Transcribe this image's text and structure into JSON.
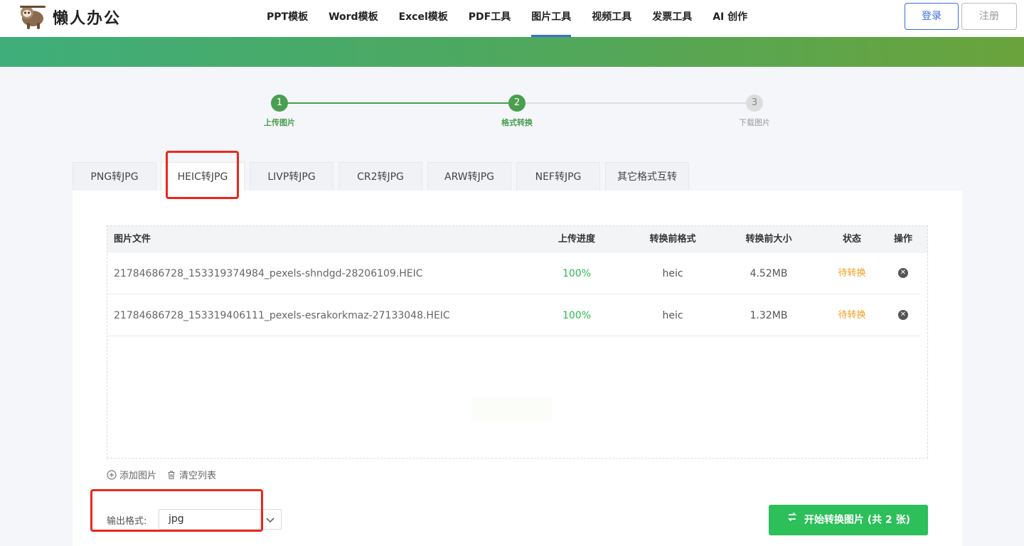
{
  "header": {
    "logo_text": "懒人办公",
    "nav": [
      "PPT模板",
      "Word模板",
      "Excel模板",
      "PDF工具",
      "图片工具",
      "视频工具",
      "发票工具",
      "AI 创作"
    ],
    "active_nav": "图片工具",
    "login_label": "登录",
    "register_label": "注册"
  },
  "steps": [
    {
      "num": "1",
      "label": "上传图片",
      "state": "done"
    },
    {
      "num": "2",
      "label": "格式转换",
      "state": "active"
    },
    {
      "num": "3",
      "label": "下载图片",
      "state": "pending"
    }
  ],
  "tabs": [
    "PNG转JPG",
    "HEIC转JPG",
    "LIVP转JPG",
    "CR2转JPG",
    "ARW转JPG",
    "NEF转JPG",
    "其它格式互转"
  ],
  "active_tab": "HEIC转JPG",
  "table": {
    "headers": {
      "file": "图片文件",
      "progress": "上传进度",
      "format": "转换前格式",
      "size": "转换前大小",
      "status": "状态",
      "action": "操作"
    },
    "rows": [
      {
        "file": "21784686728_153319374984_pexels-shndgd-28206109.HEIC",
        "progress": "100%",
        "format": "heic",
        "size": "4.52MB",
        "status": "待转换"
      },
      {
        "file": "21784686728_153319406111_pexels-esrakorkmaz-27133048.HEIC",
        "progress": "100%",
        "format": "heic",
        "size": "1.32MB",
        "status": "待转换"
      }
    ]
  },
  "actions": {
    "add_label": "添加图片",
    "clear_label": "清空列表"
  },
  "output": {
    "label": "输出格式:",
    "value": "jpg"
  },
  "start_button": "开始转换图片 (共 2 张)",
  "colors": {
    "accent_green": "#4a9e4f",
    "button_green": "#2cbf5a",
    "link_blue": "#3a6fd8",
    "status_orange": "#f0a020",
    "highlight_red": "#e8281c"
  }
}
